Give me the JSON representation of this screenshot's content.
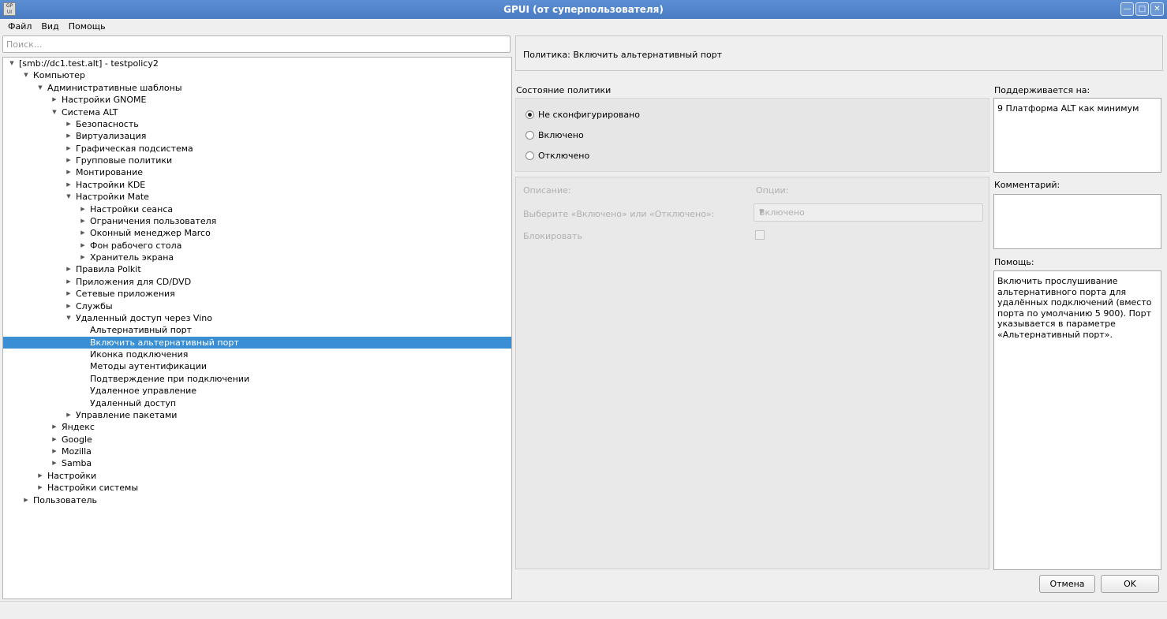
{
  "window": {
    "icon_text": "GP UI",
    "title": "GPUI (от суперпользователя)",
    "buttons": [
      "minimize-icon",
      "maximize-icon",
      "close-icon"
    ]
  },
  "menu": [
    "Файл",
    "Вид",
    "Помощь"
  ],
  "search": {
    "placeholder": "Поиск...",
    "value": ""
  },
  "tree": [
    {
      "label": "[smb://dc1.test.alt] - testpolicy2",
      "level": 0,
      "arrow": "expanded"
    },
    {
      "label": "Компьютер",
      "level": 1,
      "arrow": "expanded"
    },
    {
      "label": "Административные шаблоны",
      "level": 2,
      "arrow": "expanded"
    },
    {
      "label": "Настройки GNOME",
      "level": 3,
      "arrow": "collapsed"
    },
    {
      "label": "Система ALT",
      "level": 3,
      "arrow": "expanded"
    },
    {
      "label": "Безопасность",
      "level": 4,
      "arrow": "collapsed"
    },
    {
      "label": "Виртуализация",
      "level": 4,
      "arrow": "collapsed"
    },
    {
      "label": "Графическая подсистема",
      "level": 4,
      "arrow": "collapsed"
    },
    {
      "label": "Групповые политики",
      "level": 4,
      "arrow": "collapsed"
    },
    {
      "label": "Монтирование",
      "level": 4,
      "arrow": "collapsed"
    },
    {
      "label": "Настройки KDE",
      "level": 4,
      "arrow": "collapsed"
    },
    {
      "label": "Настройки Mate",
      "level": 4,
      "arrow": "expanded"
    },
    {
      "label": "Настройки сеанса",
      "level": 5,
      "arrow": "collapsed"
    },
    {
      "label": "Ограничения пользователя",
      "level": 5,
      "arrow": "collapsed"
    },
    {
      "label": "Оконный менеджер Marco",
      "level": 5,
      "arrow": "collapsed"
    },
    {
      "label": "Фон рабочего стола",
      "level": 5,
      "arrow": "collapsed"
    },
    {
      "label": "Хранитель экрана",
      "level": 5,
      "arrow": "collapsed"
    },
    {
      "label": "Правила Polkit",
      "level": 4,
      "arrow": "collapsed"
    },
    {
      "label": "Приложения для CD/DVD",
      "level": 4,
      "arrow": "collapsed"
    },
    {
      "label": "Сетевые приложения",
      "level": 4,
      "arrow": "collapsed"
    },
    {
      "label": "Службы",
      "level": 4,
      "arrow": "collapsed"
    },
    {
      "label": "Удаленный доступ через Vino",
      "level": 4,
      "arrow": "expanded"
    },
    {
      "label": "Альтернативный порт",
      "level": 5,
      "arrow": "none"
    },
    {
      "label": "Включить альтернативный порт",
      "level": 5,
      "arrow": "none",
      "selected": true
    },
    {
      "label": "Иконка подключения",
      "level": 5,
      "arrow": "none"
    },
    {
      "label": "Методы аутентификации",
      "level": 5,
      "arrow": "none"
    },
    {
      "label": "Подтверждение при подключении",
      "level": 5,
      "arrow": "none"
    },
    {
      "label": "Удаленное управление",
      "level": 5,
      "arrow": "none"
    },
    {
      "label": "Удаленный доступ",
      "level": 5,
      "arrow": "none"
    },
    {
      "label": "Управление пакетами",
      "level": 4,
      "arrow": "collapsed"
    },
    {
      "label": "Яндекс",
      "level": 3,
      "arrow": "collapsed"
    },
    {
      "label": "Google",
      "level": 3,
      "arrow": "collapsed"
    },
    {
      "label": "Mozilla",
      "level": 3,
      "arrow": "collapsed"
    },
    {
      "label": "Samba",
      "level": 3,
      "arrow": "collapsed"
    },
    {
      "label": "Настройки",
      "level": 2,
      "arrow": "collapsed"
    },
    {
      "label": "Настройки системы",
      "level": 2,
      "arrow": "collapsed"
    },
    {
      "label": "Пользователь",
      "level": 1,
      "arrow": "collapsed"
    }
  ],
  "policy": {
    "title": "Политика: Включить альтернативный порт",
    "state_label": "Состояние политики",
    "states": [
      {
        "label": "Не сконфигурировано",
        "checked": true
      },
      {
        "label": "Включено",
        "checked": false
      },
      {
        "label": "Отключено",
        "checked": false
      }
    ],
    "description_label": "Описание:",
    "options_label": "Опции:",
    "choose_label": "Выберите «Включено» или «Отключено»:",
    "combo_value": "Включено",
    "lock_label": "Блокировать"
  },
  "supported": {
    "label": "Поддерживается на:",
    "value": "9 Платформа ALT как минимум"
  },
  "comment": {
    "label": "Комментарий:",
    "value": ""
  },
  "help": {
    "label": "Помощь:",
    "text": "Включить прослушивание альтернативного порта для удалённых подключений (вместо порта по умолчанию 5 900). Порт указывается в параметре «Альтернативный порт»."
  },
  "buttons": {
    "cancel": "Отмена",
    "ok": "OK"
  }
}
